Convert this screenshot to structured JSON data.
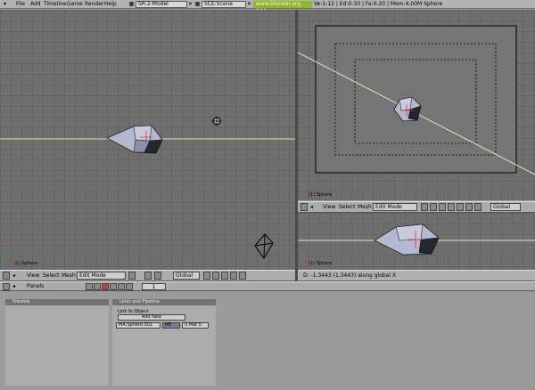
{
  "menubar": {
    "items": [
      "File",
      "Add",
      "Timeline",
      "Game",
      "Render",
      "Help"
    ],
    "screen": "SR:2-Model",
    "scene": "SCE:Scene",
    "url": "www.blender.org 244",
    "stats": "Ve:1-12 | Ed:0-30 | Fa:0-20 | Mem:4.00M Sphere"
  },
  "viewport_left": {
    "object_label": "(1) Sphere",
    "header": {
      "view": "View",
      "select": "Select",
      "mesh": "Mesh",
      "mode": "Edit Mode",
      "orientation": "Global"
    }
  },
  "viewport_top_right": {
    "object_label": "(1) Sphere",
    "header": {
      "view": "View",
      "select": "Select",
      "mesh": "Mesh",
      "mode": "Edit Mode",
      "orientation": "Global"
    }
  },
  "viewport_bottom_right": {
    "object_label": "(1) Sphere",
    "status": "D: -1.3443 (1.3443) along global X"
  },
  "buttons_header": {
    "panels_label": "Panels",
    "frame": "1"
  },
  "panels": {
    "preview": "Preview",
    "links": {
      "title": "Links and Pipeline",
      "link_to_object": "Link to Object",
      "add_new": "Add New",
      "material_field": "MA:Sphere.001",
      "me_button": "ME",
      "mat_count": "0 Mat 0"
    }
  },
  "colors": {
    "viewport_bg": "#6f6f6f",
    "grid": "#646464",
    "header_bg": "#ababab",
    "url_green": "#8fb52f",
    "mesh_face": "#b9bdd6"
  }
}
